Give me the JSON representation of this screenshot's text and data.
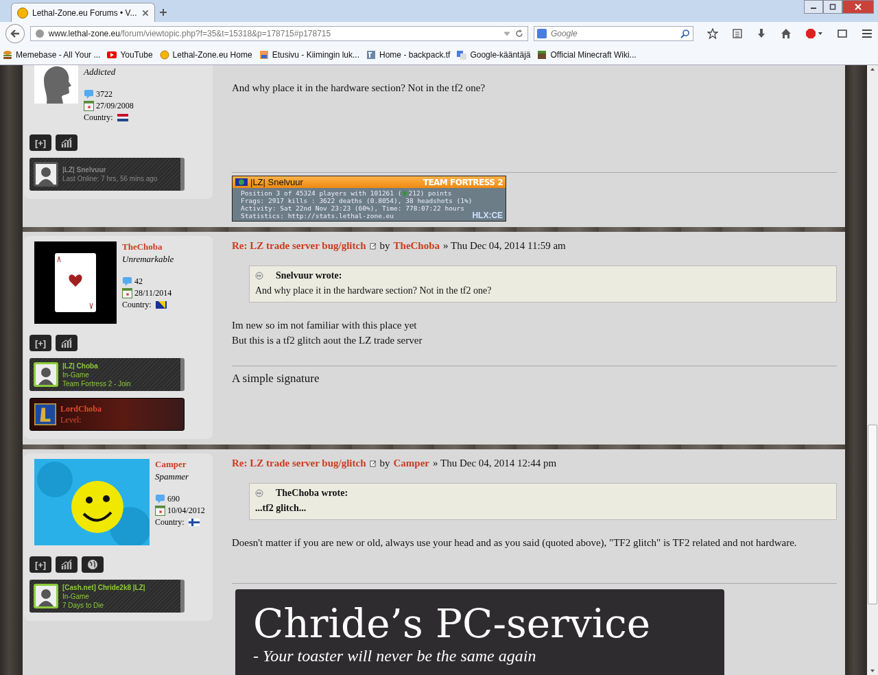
{
  "browser": {
    "tab_title": "Lethal-Zone.eu Forums • V...",
    "url_host": "www.lethal-zone.eu",
    "url_path": "/forum/viewtopic.php?f=35&t=15318&p=178715#p178715",
    "search_placeholder": "Google",
    "bookmarks": [
      {
        "kind": "burger",
        "label": "Memebase - All Your ..."
      },
      {
        "kind": "youtube",
        "label": "YouTube"
      },
      {
        "kind": "circle",
        "label": "Lethal-Zone.eu Home"
      },
      {
        "kind": "pixel",
        "label": "Etusivu - Kiimingin luk..."
      },
      {
        "kind": "tf",
        "label": "Home - backpack.tf"
      },
      {
        "kind": "translate",
        "label": "Google-kääntäjä"
      },
      {
        "kind": "block",
        "label": "Official Minecraft Wiki..."
      }
    ]
  },
  "posts": [
    {
      "avatar": {
        "kind": "silhouette"
      },
      "rank": "Addicted",
      "post_count": "3722",
      "joined": "27/09/2008",
      "country_label": "Country:",
      "flag": {
        "kind": "nl"
      },
      "buttons": [
        {
          "kind": "text",
          "label": "[+]"
        },
        {
          "kind": "stats"
        }
      ],
      "badges": [
        {
          "kind": "steam",
          "in_game": false,
          "name": "|LZ| Snelvuur",
          "lines": [
            "Last Online: 7 hrs, 56 mins ago"
          ]
        }
      ],
      "body": [
        "And why place it in the hardware section? Not in the tf2 one?"
      ],
      "signature": {
        "kind": "hlx",
        "player": "|LZ| Snelvuur",
        "game": "TEAM FORTRESS 2",
        "line_pre": "Position 3 of 45324 players with 101261 (",
        "line_post": "212) points",
        "lines": [
          "Frags: 2917 kills : 3622 deaths (0.8054), 38 headshots (1%)",
          "Activity: Sat 22nd Nov 23:23 (60%), Time: 778:07:22 hours",
          "Statistics: http://stats.lethal-zone.eu"
        ],
        "brand": "HLX:CE"
      }
    },
    {
      "avatar": {
        "kind": "card"
      },
      "author": "TheChoba",
      "rank": "Unremarkable",
      "post_count": "42",
      "joined": "28/11/2014",
      "country_label": "Country:",
      "flag": {
        "kind": "ba"
      },
      "buttons": [
        {
          "kind": "text",
          "label": "[+]"
        },
        {
          "kind": "stats"
        }
      ],
      "badges": [
        {
          "kind": "steam",
          "in_game": true,
          "name": "|LZ| Choba",
          "lines": [
            "In-Game",
            "Team Fortress 2 - Join"
          ]
        },
        {
          "kind": "lol",
          "name": "LordChoba",
          "lines": [
            "Level:"
          ]
        }
      ],
      "title": "Re: LZ trade server bug/glitch",
      "by": "by",
      "title_author": "TheChoba",
      "date": "» Thu Dec 04, 2014 11:59 am",
      "quote": {
        "author": "Snelvuur wrote:",
        "text": "And why place it in the hardware section? Not in the tf2 one?"
      },
      "body": [
        "Im new so im not familiar with this place yet",
        "But this is a tf2 glitch aout the LZ trade server"
      ],
      "signature": {
        "kind": "text",
        "text": "A simple signature"
      }
    },
    {
      "avatar": {
        "kind": "photo"
      },
      "author": "Camper",
      "rank": "Spammer",
      "post_count": "690",
      "joined": "10/04/2012",
      "country_label": "Country:",
      "flag": {
        "kind": "fi"
      },
      "buttons": [
        {
          "kind": "text",
          "label": "[+]"
        },
        {
          "kind": "stats"
        },
        {
          "kind": "globe"
        }
      ],
      "badges": [
        {
          "kind": "steam",
          "in_game": true,
          "name": "[Cash.net] Chride2k8 |LZ|",
          "lines": [
            "In-Game",
            "7 Days to Die"
          ]
        }
      ],
      "title": "Re: LZ trade server bug/glitch",
      "by": "by",
      "title_author": "Camper",
      "date": "» Thu Dec 04, 2014 12:44 pm",
      "quote": {
        "author": "TheChoba wrote:",
        "text": "...tf2 glitch..."
      },
      "body": [
        "Doesn't matter if you are new or old, always use your head and as you said (quoted above), \"TF2 glitch\" is TF2 related and not hardware."
      ],
      "signature": {
        "kind": "banner",
        "title": "Chride’s PC-service",
        "subtitle": "- Your toaster will never be the same again"
      }
    }
  ]
}
